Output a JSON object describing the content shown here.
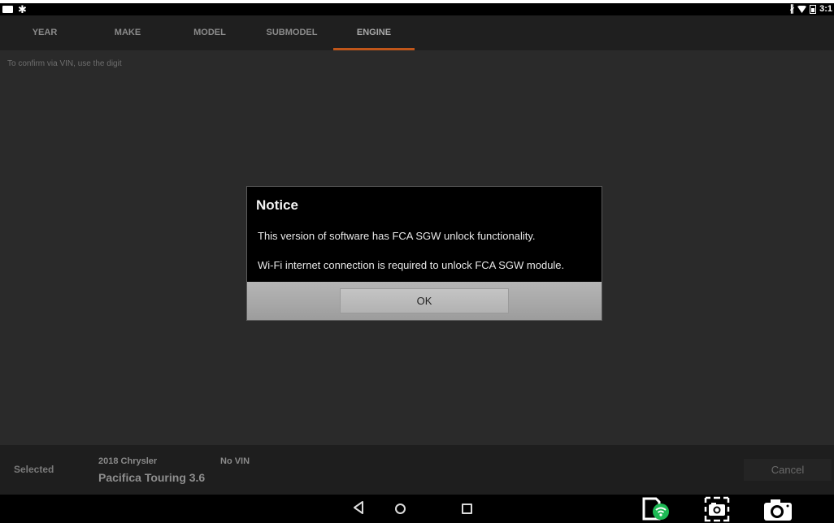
{
  "status_bar": {
    "time": "3:1",
    "icons": [
      "notification-box-icon",
      "gear-notification-icon",
      "bluetooth-icon",
      "wifi-icon",
      "battery-icon"
    ]
  },
  "tabs": [
    {
      "label": "YEAR"
    },
    {
      "label": "MAKE"
    },
    {
      "label": "MODEL"
    },
    {
      "label": "SUBMODEL"
    },
    {
      "label": "ENGINE",
      "active": true
    }
  ],
  "hint_text": "To confirm via VIN, use the  digit",
  "dialog": {
    "title": "Notice",
    "line1": "This version of software has FCA SGW unlock functionality.",
    "line2": "Wi-Fi internet connection is required to unlock FCA SGW module.",
    "ok_label": "OK"
  },
  "bottom": {
    "selected_label": "Selected",
    "vehicle_year_make": "2018 Chrysler",
    "vehicle_model": "Pacifica Touring 3.6",
    "vin_status": "No VIN",
    "cancel_label": "Cancel"
  },
  "nav_bar": {
    "icons": [
      "back-icon",
      "home-icon",
      "recent-apps-icon",
      "wifi-device-icon",
      "screen-capture-icon",
      "camera-icon"
    ]
  },
  "colors": {
    "accent": "#c0561a",
    "wifi_green": "#1db954"
  }
}
